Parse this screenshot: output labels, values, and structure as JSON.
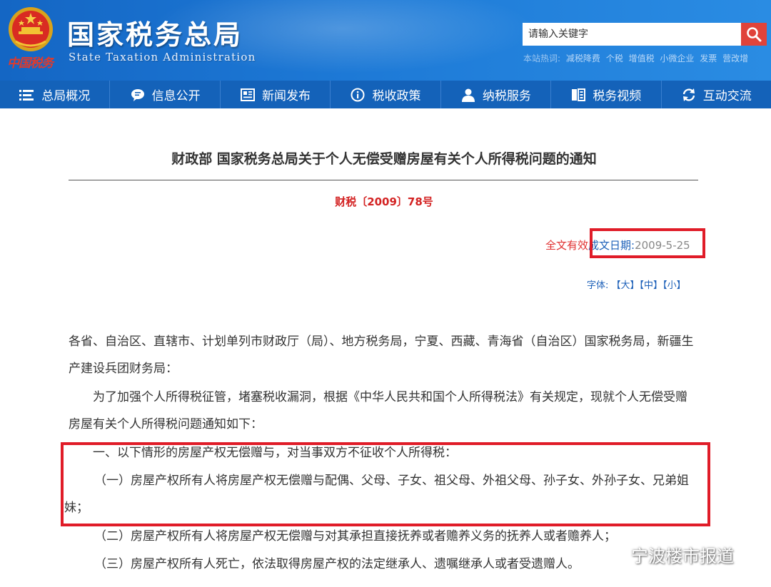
{
  "header": {
    "site_title_cn": "国家税务总局",
    "site_title_en": "State Taxation Administration",
    "seal_text": "中国税务",
    "search": {
      "placeholder": "请输入关键字"
    },
    "hot_label": "本站热词:",
    "hot_words": [
      "减税降费",
      "个税",
      "增值税",
      "小微企业",
      "发票",
      "营改增"
    ]
  },
  "nav": {
    "items": [
      {
        "label": "总局概况",
        "icon": "menu-icon"
      },
      {
        "label": "信息公开",
        "icon": "chat-bubble-icon"
      },
      {
        "label": "新闻发布",
        "icon": "newspaper-icon"
      },
      {
        "label": "税收政策",
        "icon": "info-icon"
      },
      {
        "label": "纳税服务",
        "icon": "person-icon"
      },
      {
        "label": "税务视频",
        "icon": "video-icon"
      },
      {
        "label": "互动交流",
        "icon": "refresh-icon"
      }
    ]
  },
  "article": {
    "title": "财政部 国家税务总局关于个人无偿受赠房屋有关个人所得税问题的通知",
    "doc_number": "财税〔2009〕78号",
    "validity": "全文有效",
    "date_label": "成文日期:",
    "date_value": "2009-5-25",
    "font_size_label": "字体:",
    "font_size_options": [
      "【大】",
      "【中】",
      "【小】"
    ],
    "paragraphs": [
      "各省、自治区、直辖市、计划单列市财政厅（局）、地方税务局，宁夏、西藏、青海省（自治区）国家税务局，新疆生产建设兵团财务局：",
      "为了加强个人所得税征管，堵塞税收漏洞，根据《中华人民共和国个人所得税法》有关规定，现就个人无偿受赠房屋有关个人所得税问题通知如下：",
      "一、以下情形的房屋产权无偿赠与，对当事双方不征收个人所得税：",
      "（一）房屋产权所有人将房屋产权无偿赠与配偶、父母、子女、祖父母、外祖父母、孙子女、外孙子女、兄弟姐妹；",
      "（二）房屋产权所有人将房屋产权无偿赠与对其承担直接抚养或者赡养义务的抚养人或者赡养人；",
      "（三）房屋产权所有人死亡，依法取得房屋产权的法定继承人、遗嘱继承人或者受遗赠人。"
    ]
  },
  "watermark": {
    "text": "宁波楼市报道",
    "icon": "wechat-icon"
  },
  "colors": {
    "header_blue": "#1d79d6",
    "nav_blue": "#1462b9",
    "search_red": "#e0433a",
    "highlight_red": "#e01c28",
    "doc_number_red": "#d32222",
    "link_blue": "#1b5fb8"
  }
}
